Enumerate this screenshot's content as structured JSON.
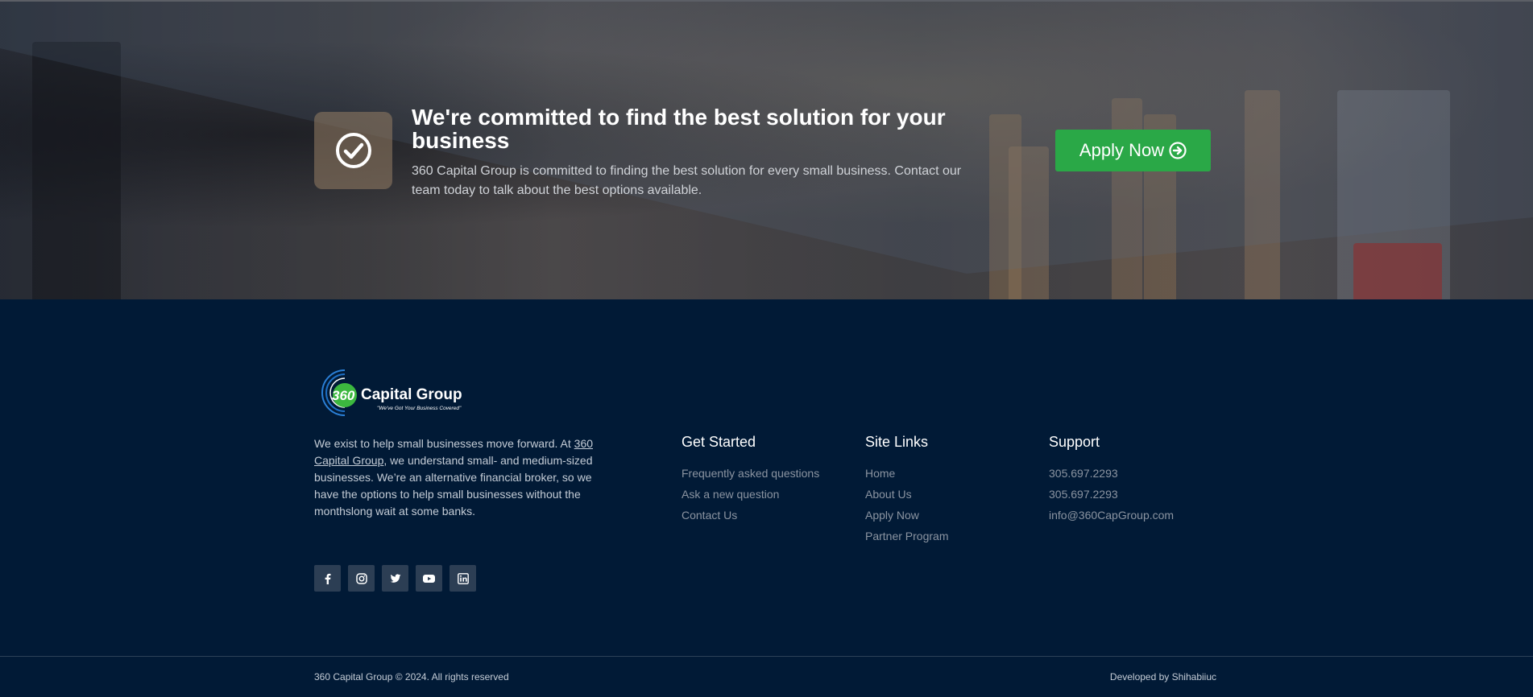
{
  "cta": {
    "title": "We're committed to find the best solution for your business",
    "text": "360 Capital Group is committed to finding the best solution for every small business. Contact our team today to talk about the best options available.",
    "apply_label": "Apply Now",
    "icon": "check-circle-icon"
  },
  "footer": {
    "logo": {
      "number": "360",
      "name": "Capital Group",
      "tagline": "\"We've Got Your Business Covered\""
    },
    "about": {
      "before": "We exist to help small businesses move forward. At ",
      "link": "360 Capital Group",
      "after": ", we understand small- and medium-sized businesses. We’re an alternative financial broker, so we have the options to help small businesses without the monthslong wait at some banks."
    },
    "social": [
      "facebook-icon",
      "instagram-icon",
      "twitter-icon",
      "youtube-icon",
      "linkedin-icon"
    ],
    "columns": [
      {
        "title": "Get Started",
        "links": [
          "Frequently asked questions",
          "Ask a new question",
          "Contact Us"
        ]
      },
      {
        "title": "Site Links",
        "links": [
          "Home",
          "About Us",
          "Apply Now",
          "Partner Program"
        ]
      },
      {
        "title": "Support",
        "links": [
          "305.697.2293",
          "305.697.2293",
          "info@360CapGroup.com"
        ]
      }
    ],
    "copyright": "360 Capital Group © 2024. All rights reserved",
    "developed": "Developed by Shihabiiuc"
  },
  "colors": {
    "footer_bg": "#011a36",
    "button_green": "#2aa847",
    "logo_green": "#3cb83f",
    "logo_blue": "#2a7fd6"
  }
}
